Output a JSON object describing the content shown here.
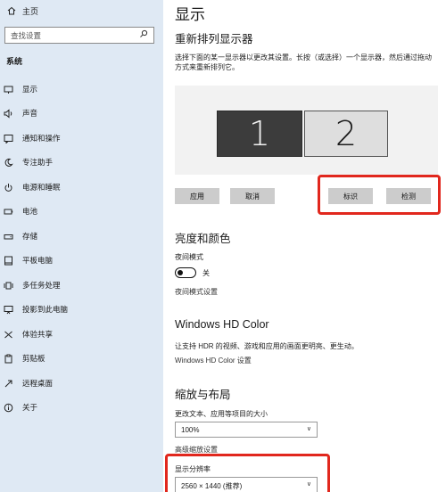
{
  "sidebar": {
    "home": "主页",
    "search_placeholder": "查找设置",
    "section": "系统",
    "items": [
      {
        "label": "显示",
        "icon": "monitor-icon"
      },
      {
        "label": "声音",
        "icon": "speaker-icon"
      },
      {
        "label": "通知和操作",
        "icon": "notification-icon"
      },
      {
        "label": "专注助手",
        "icon": "moon-icon"
      },
      {
        "label": "电源和睡眠",
        "icon": "power-icon"
      },
      {
        "label": "电池",
        "icon": "battery-icon"
      },
      {
        "label": "存储",
        "icon": "storage-icon"
      },
      {
        "label": "平板电脑",
        "icon": "tablet-icon"
      },
      {
        "label": "多任务处理",
        "icon": "multitask-icon"
      },
      {
        "label": "投影到此电脑",
        "icon": "project-icon"
      },
      {
        "label": "体验共享",
        "icon": "share-icon"
      },
      {
        "label": "剪贴板",
        "icon": "clipboard-icon"
      },
      {
        "label": "远程桌面",
        "icon": "remote-icon"
      },
      {
        "label": "关于",
        "icon": "info-icon"
      }
    ]
  },
  "main": {
    "title": "显示",
    "rearrange": {
      "heading": "重新排列显示器",
      "description": "选择下面的某一显示器以更改其设置。长按（或选择）一个显示器，然后通过拖动方式来重新排列它。",
      "monitors": [
        "1",
        "2"
      ],
      "apply": "应用",
      "cancel": "取消",
      "identify": "标识",
      "detect": "检测"
    },
    "brightness": {
      "heading": "亮度和颜色",
      "night_light_label": "夜间模式",
      "night_light_state": "关",
      "night_light_settings": "夜间模式设置"
    },
    "hdr": {
      "heading": "Windows HD Color",
      "description": "让支持 HDR 的视频、游戏和应用的画面更明亮、更生动。",
      "settings_link": "Windows HD Color 设置"
    },
    "scale": {
      "heading": "缩放与布局",
      "scale_label": "更改文本、应用等项目的大小",
      "scale_value": "100%",
      "advanced_link": "高级缩放设置",
      "resolution_label": "显示分辨率",
      "resolution_value": "2560 × 1440 (推荐)"
    }
  },
  "colors": {
    "sidebar_bg": "#dfe9f4",
    "highlight": "#e1271d",
    "monitor_selected": "#3c3c3c"
  }
}
